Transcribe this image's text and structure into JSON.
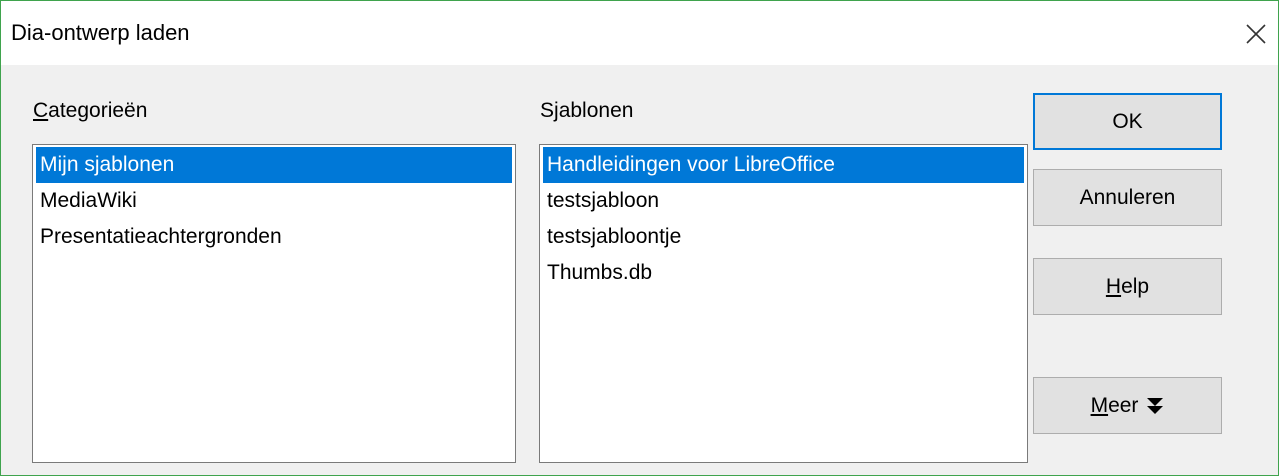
{
  "dialog": {
    "title": "Dia-ontwerp laden",
    "close_icon": "close-icon"
  },
  "categories": {
    "label_mnemonic": "C",
    "label_rest": "ategorieën",
    "items": [
      {
        "label": "Mijn sjablonen",
        "selected": true
      },
      {
        "label": "MediaWiki",
        "selected": false
      },
      {
        "label": "Presentatieachtergronden",
        "selected": false
      }
    ]
  },
  "templates": {
    "label_pre": "S",
    "label_mnemonic": "j",
    "label_rest": "ablonen",
    "items": [
      {
        "label": "Handleidingen voor LibreOffice",
        "selected": true
      },
      {
        "label": "testsjabloon",
        "selected": false
      },
      {
        "label": "testsjabloontje",
        "selected": false
      },
      {
        "label": "Thumbs.db",
        "selected": false
      }
    ]
  },
  "buttons": {
    "ok": "OK",
    "cancel": "Annuleren",
    "help_mnemonic": "H",
    "help_rest": "elp",
    "more_mnemonic": "M",
    "more_rest": "eer",
    "more_icon": "double-chevron-down-icon"
  },
  "colors": {
    "selection": "#0078d7",
    "window_border": "#3fa34d",
    "dialog_bg": "#f0f0f0"
  }
}
